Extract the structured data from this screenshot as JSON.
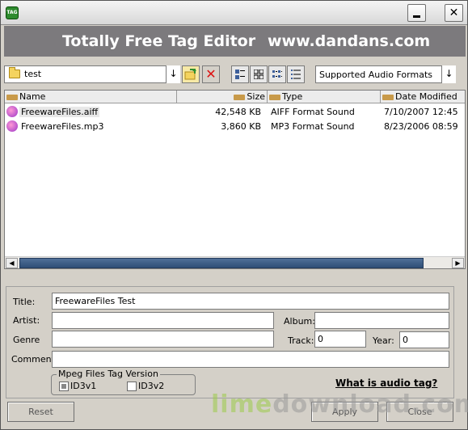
{
  "titlebar": {
    "app_icon_text": "TAG",
    "minimize_icon": "minimize-icon",
    "close_icon": "close-icon",
    "close_glyph": "✕"
  },
  "banner": {
    "title": "Totally Free Tag Editor",
    "website": "www.dandans.com"
  },
  "toolbar": {
    "folder_value": "test",
    "formats_value": "Supported Audio Formats",
    "arrow_glyph": "↓",
    "open_icon": "open-folder-icon",
    "delete_icon": "delete-icon",
    "delete_glyph": "✕",
    "view_icons": [
      "large-icons-view-icon",
      "small-icons-view-icon",
      "list-view-icon",
      "details-view-icon"
    ]
  },
  "file_list": {
    "columns": [
      "Name",
      "Size",
      "Type",
      "Date Modified"
    ],
    "rows": [
      {
        "name": "FreewareFiles.aiff",
        "size": "42,548 KB",
        "type": "AIFF Format Sound",
        "date": "7/10/2007 12:45"
      },
      {
        "name": "FreewareFiles.mp3",
        "size": "3,860 KB",
        "type": "MP3 Format Sound",
        "date": "8/23/2006 08:59"
      }
    ],
    "scroll_left_glyph": "◀",
    "scroll_right_glyph": "▶"
  },
  "tags": {
    "title_label": "Title:",
    "title_value": "FreewareFiles Test",
    "artist_label": "Artist:",
    "artist_value": "",
    "album_label": "Album:",
    "album_value": "",
    "genre_label": "Genre",
    "genre_value": "",
    "track_label": "Track:",
    "track_value": "0",
    "year_label": "Year:",
    "year_value": "0",
    "comment_label": "Comment:",
    "comment_value": ""
  },
  "mpeg": {
    "group_title": "Mpeg Files Tag Version",
    "id3v1_label": "ID3v1",
    "id3v1_checked": true,
    "id3v2_label": "ID3v2",
    "id3v2_checked": false
  },
  "help_link": "What is audio tag?",
  "buttons": {
    "reset": "Reset",
    "apply": "Apply",
    "close": "Close"
  },
  "watermark": {
    "part_a": "lime",
    "part_b": "download.com"
  }
}
